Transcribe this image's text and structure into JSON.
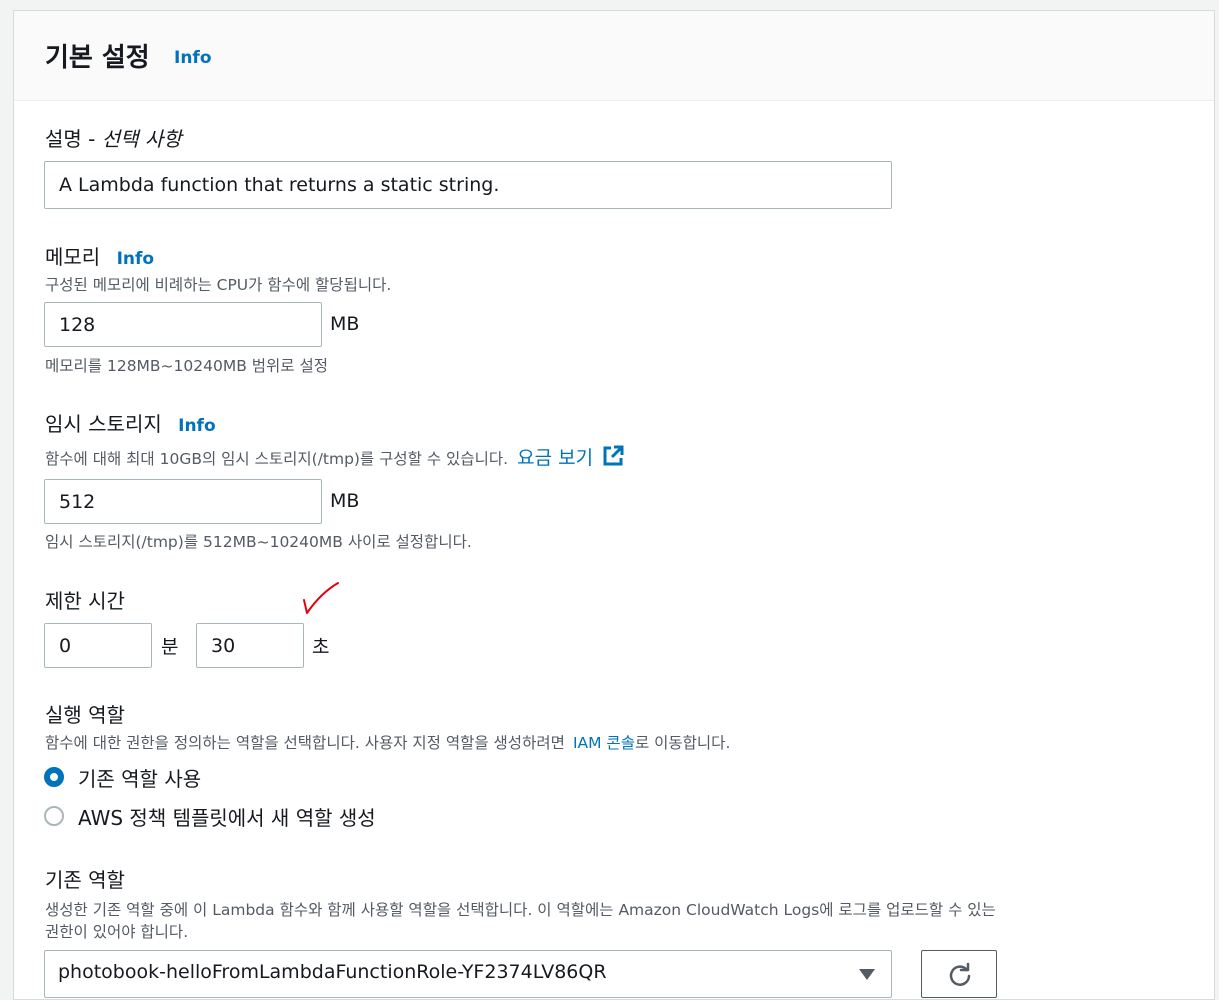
{
  "header": {
    "title": "기본 설정",
    "info": "Info"
  },
  "description": {
    "label": "설명 -",
    "optional": "선택 사항",
    "value": "A Lambda function that returns a static string."
  },
  "memory": {
    "label": "메모리",
    "info": "Info",
    "help": "구성된 메모리에 비례하는 CPU가 함수에 할당됩니다.",
    "value": "128",
    "unit": "MB",
    "constraint": "메모리를 128MB~10240MB 범위로 설정"
  },
  "ephemeral_storage": {
    "label": "임시 스토리지",
    "info": "Info",
    "help": "함수에 대해 최대 10GB의 임시 스토리지(/tmp)를 구성할 수 있습니다.",
    "pricing_link": "요금 보기",
    "value": "512",
    "unit": "MB",
    "constraint": "임시 스토리지(/tmp)를 512MB~10240MB 사이로 설정합니다."
  },
  "timeout": {
    "label": "제한 시간",
    "minutes_value": "0",
    "minutes_unit": "분",
    "seconds_value": "30",
    "seconds_unit": "초",
    "annotation_color": "#e8000b"
  },
  "execution_role": {
    "label": "실행 역할",
    "help_prefix": "함수에 대한 권한을 정의하는 역할을 선택합니다. 사용자 지정 역할을 생성하려면",
    "iam_link": "IAM 콘솔",
    "help_suffix": "로 이동합니다.",
    "options": [
      {
        "label": "기존 역할 사용",
        "selected": true
      },
      {
        "label": "AWS 정책 템플릿에서 새 역할 생성",
        "selected": false
      }
    ]
  },
  "existing_role": {
    "label": "기존 역할",
    "help_line1": "생성한 기존 역할 중에 이 Lambda 함수와 함께 사용할 역할을 선택합니다. 이 역할에는 Amazon CloudWatch Logs에 로그를 업로드할 수 있는",
    "help_line2": "권한이 있어야 합니다.",
    "selected": "photobook-helloFromLambdaFunctionRole-YF2374LV86QR"
  },
  "colors": {
    "link": "#0073bb",
    "radio_selected": "#0073bb",
    "text": "#16191f",
    "muted": "#545b64"
  }
}
